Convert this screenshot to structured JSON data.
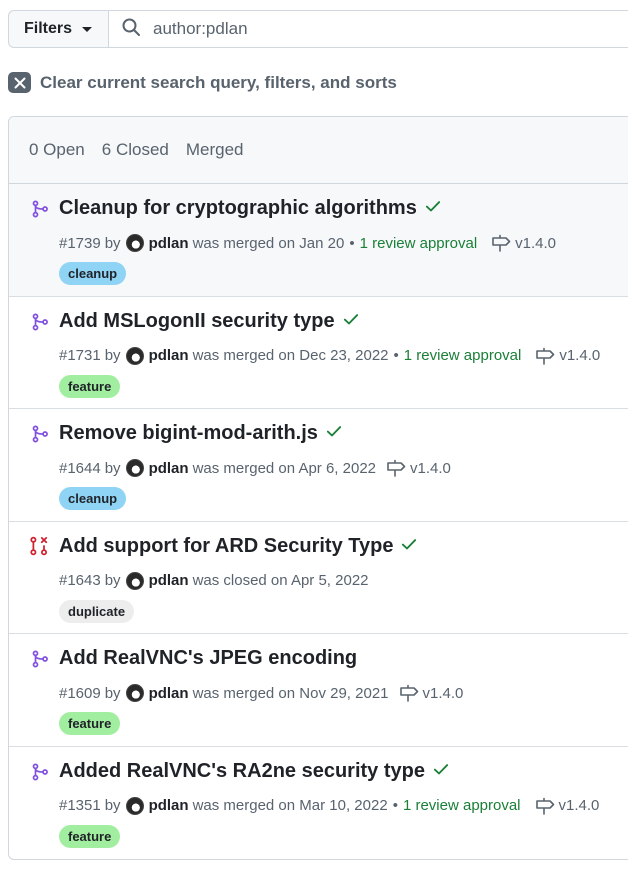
{
  "filters": {
    "label": "Filters"
  },
  "search": {
    "value": "author:pdlan"
  },
  "clear": {
    "label": "Clear current search query, filters, and sorts"
  },
  "tabs": {
    "open": "0 Open",
    "closed": "6 Closed",
    "merged": "Merged"
  },
  "colors": {
    "merged_icon": "#8250df",
    "closed_icon": "#cf222e",
    "check": "#1a7f37",
    "review": "#1a7f37",
    "label_cleanup": "#8fd3f5",
    "label_feature": "#a2eea0",
    "label_duplicate": "#ededed"
  },
  "pulls": [
    {
      "title": "Cleanup for cryptographic algorithms",
      "number": "#1739",
      "by": "by",
      "author": "pdlan",
      "status_text": "was merged on Jan 20",
      "review": "1 review approval",
      "milestone": "v1.4.0",
      "label": "cleanup",
      "state": "merged",
      "icon": "git-merge-icon",
      "checks": true
    },
    {
      "title": "Add MSLogonII security type",
      "number": "#1731",
      "by": "by",
      "author": "pdlan",
      "status_text": "was merged on Dec 23, 2022",
      "review": "1 review approval",
      "milestone": "v1.4.0",
      "label": "feature",
      "state": "merged",
      "icon": "git-merge-icon",
      "checks": true
    },
    {
      "title": "Remove bigint-mod-arith.js",
      "number": "#1644",
      "by": "by",
      "author": "pdlan",
      "status_text": "was merged on Apr 6, 2022",
      "review": "",
      "milestone": "v1.4.0",
      "label": "cleanup",
      "state": "merged",
      "icon": "git-merge-icon",
      "checks": true
    },
    {
      "title": "Add support for ARD Security Type",
      "number": "#1643",
      "by": "by",
      "author": "pdlan",
      "status_text": "was closed on Apr 5, 2022",
      "review": "",
      "milestone": "",
      "label": "duplicate",
      "state": "closed",
      "icon": "git-pull-request-closed-icon",
      "checks": true
    },
    {
      "title": "Add RealVNC's JPEG encoding",
      "number": "#1609",
      "by": "by",
      "author": "pdlan",
      "status_text": "was merged on Nov 29, 2021",
      "review": "",
      "milestone": "v1.4.0",
      "label": "feature",
      "state": "merged",
      "icon": "git-merge-icon",
      "checks": false
    },
    {
      "title": "Added RealVNC's RA2ne security type",
      "number": "#1351",
      "by": "by",
      "author": "pdlan",
      "status_text": "was merged on Mar 10, 2022",
      "review": "1 review approval",
      "milestone": "v1.4.0",
      "label": "feature",
      "state": "merged",
      "icon": "git-merge-icon",
      "checks": true
    }
  ]
}
